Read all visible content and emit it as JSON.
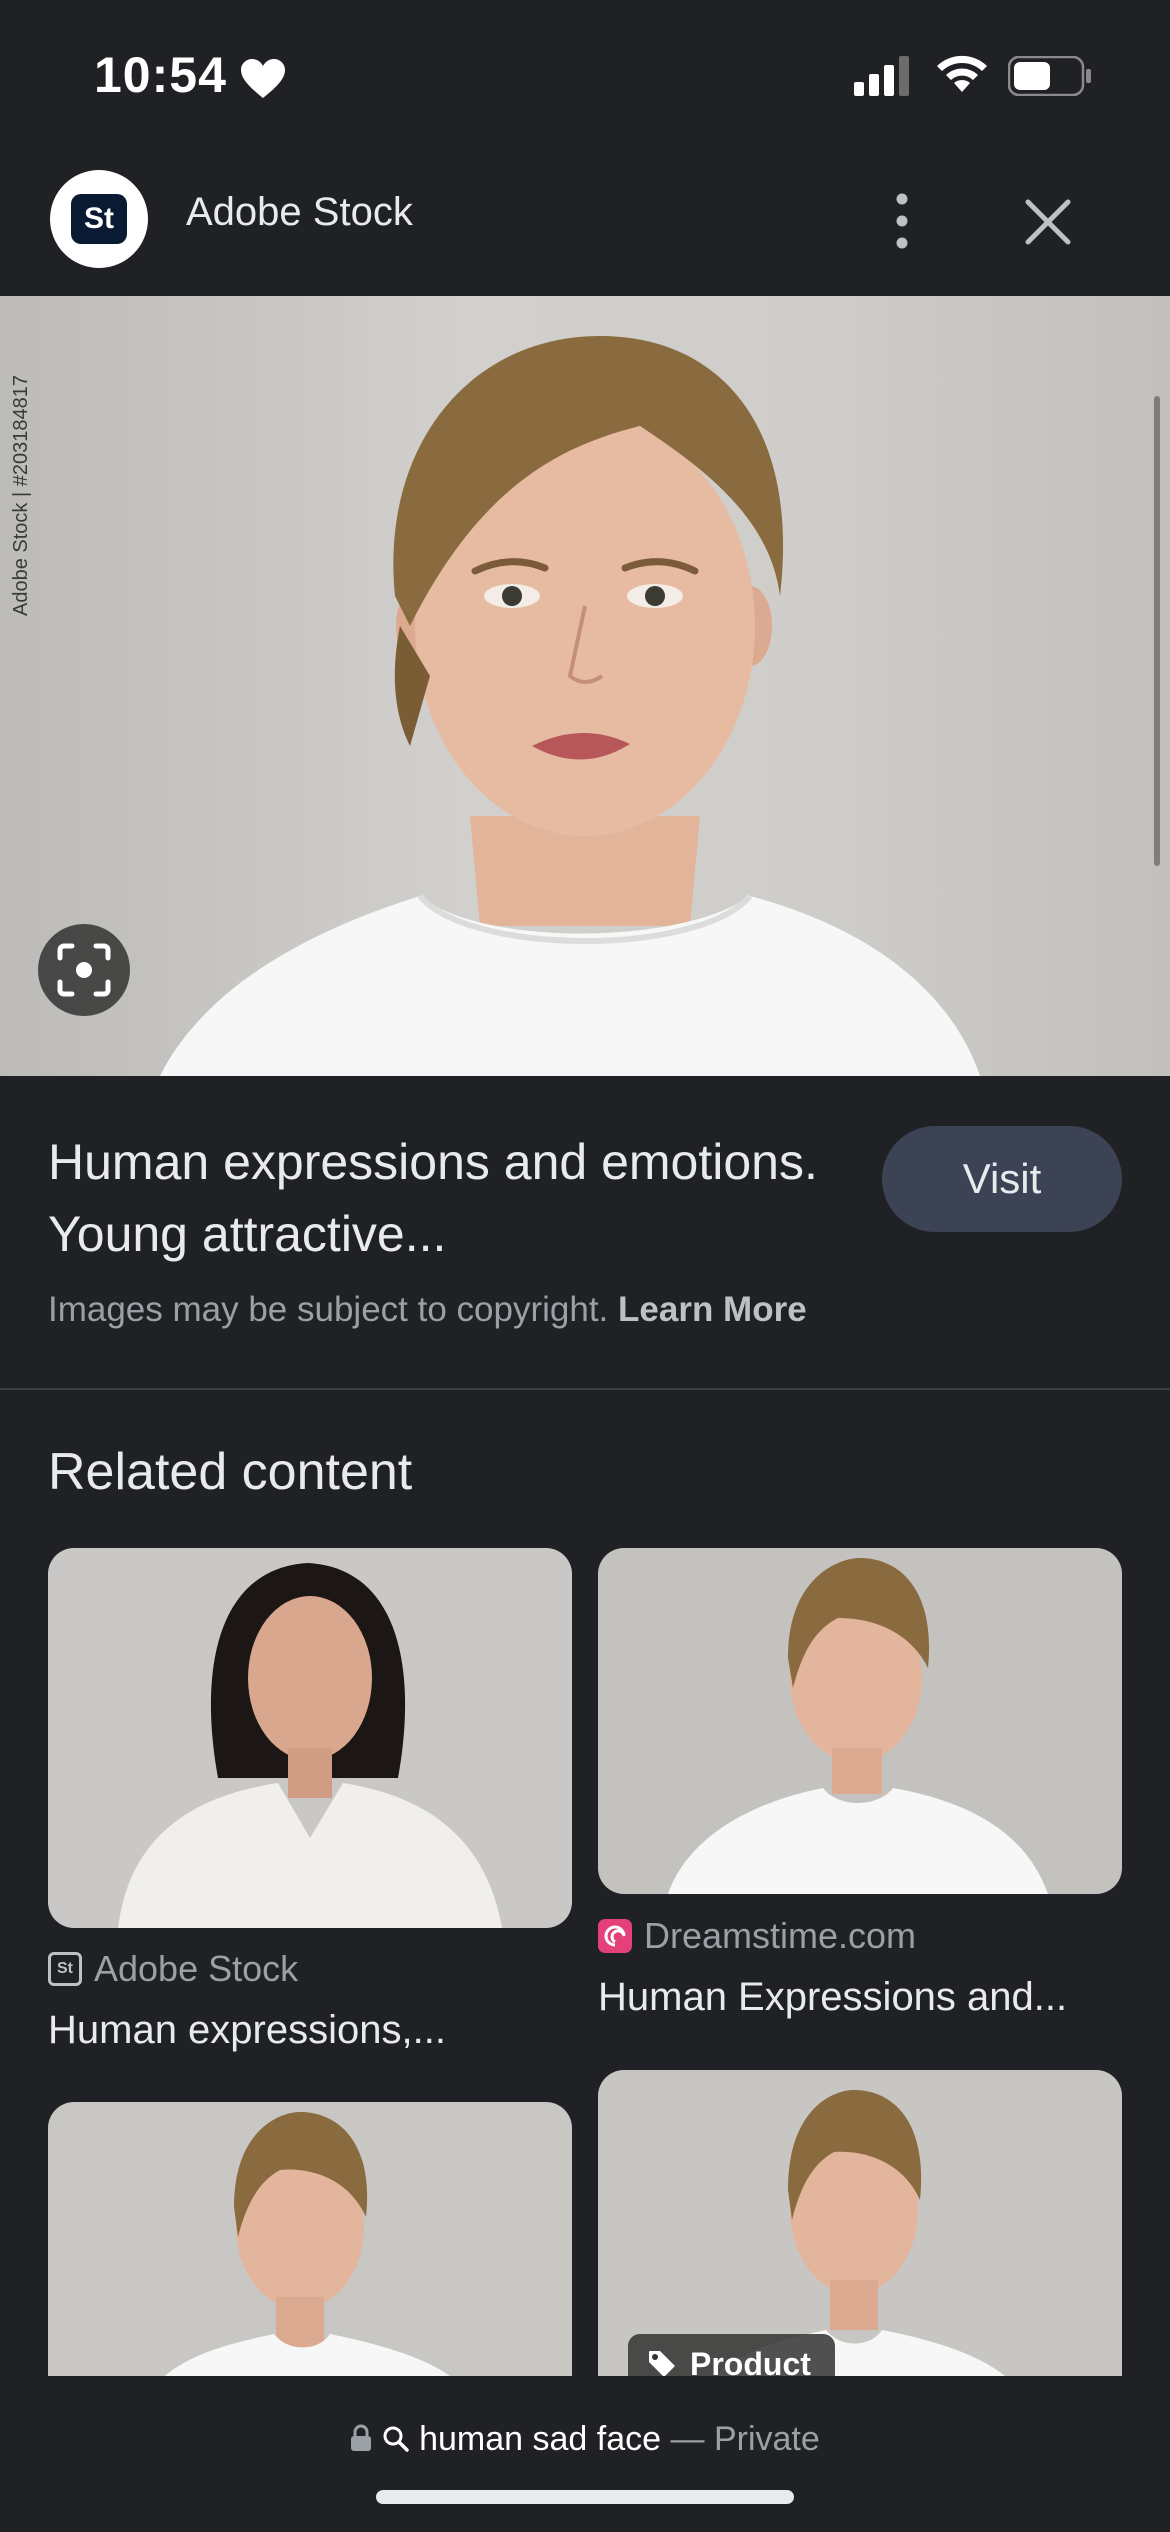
{
  "status_bar": {
    "time": "10:54"
  },
  "header": {
    "site_name": "Adobe Stock",
    "logo_text": "St"
  },
  "hero": {
    "watermark": "Adobe Stock | #203184817"
  },
  "info": {
    "title": "Human expressions and emotions. Young attractive...",
    "visit_label": "Visit",
    "copyright_text": "Images may be subject to copyright.",
    "learn_more": "Learn More"
  },
  "related": {
    "heading": "Related content",
    "cards": [
      {
        "source": "Adobe Stock",
        "title": "Human expressions,..."
      },
      {
        "source": "Dreamstime.com",
        "title": "Human Expressions and..."
      }
    ],
    "product_badge": "Product"
  },
  "bottom_bar": {
    "query": "human sad face",
    "separator": "—",
    "mode": "Private"
  }
}
